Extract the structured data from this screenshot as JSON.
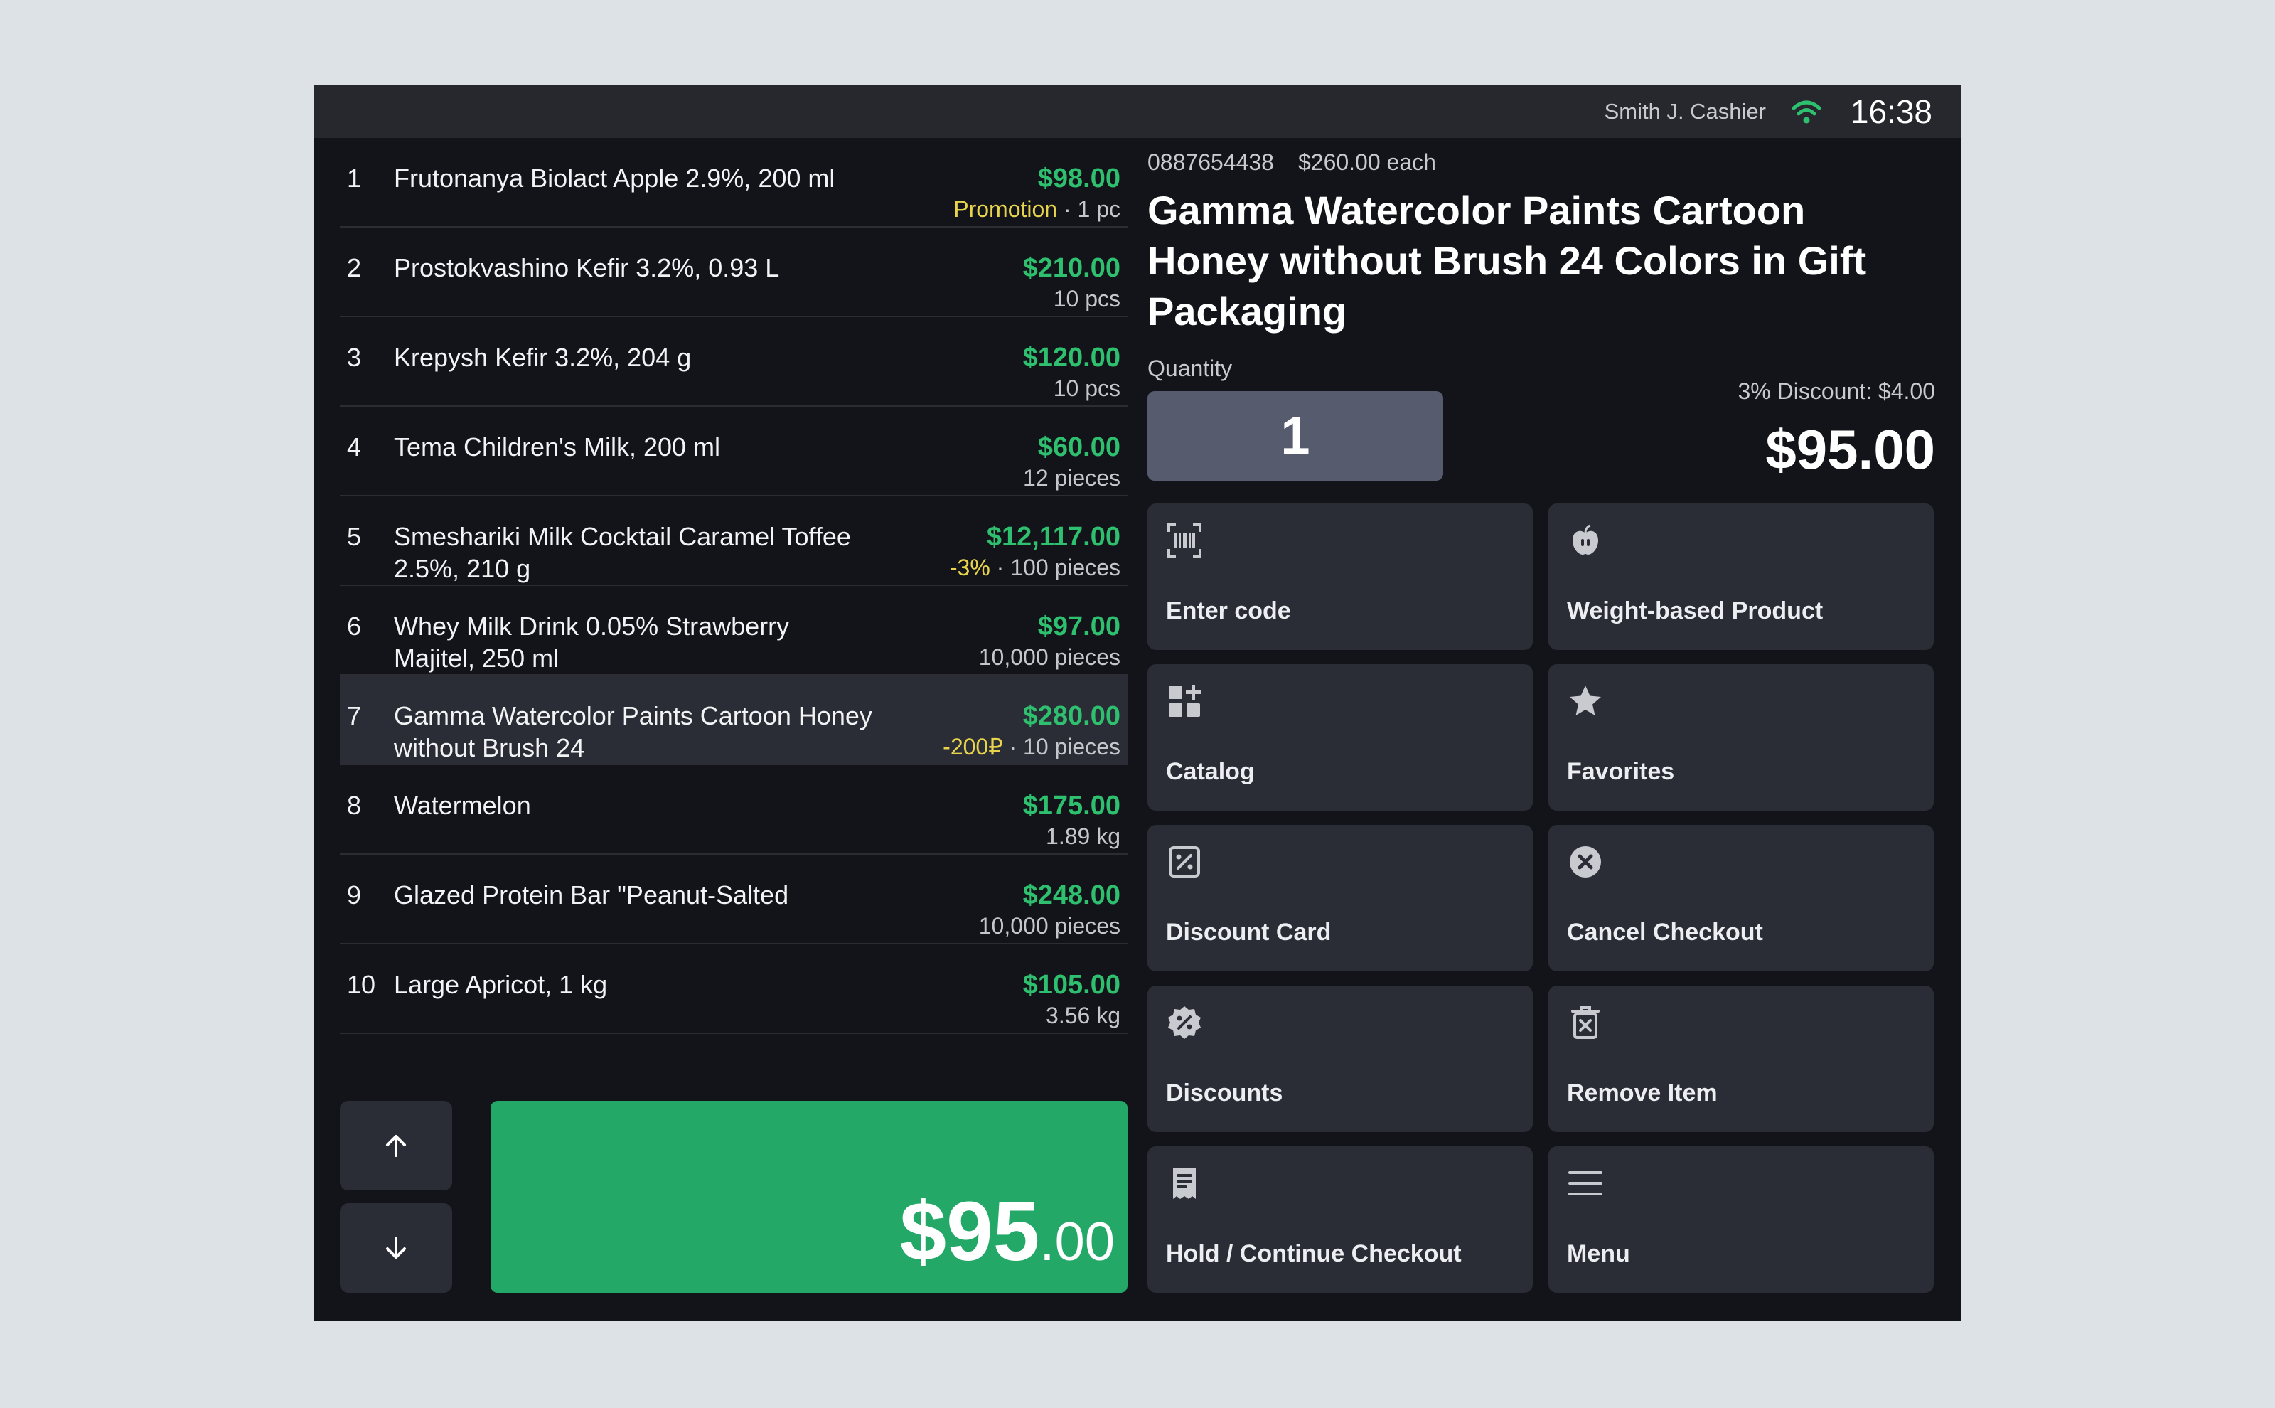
{
  "status": {
    "cashier": "Smith J. Cashier",
    "time": "16:38",
    "wifi_icon": "wifi-icon"
  },
  "receipt": [
    {
      "index": "1",
      "name": "Frutonanya Biolact Apple 2.9%, 200 ml",
      "price": "$98.00",
      "tag": "Promotion",
      "qty": "1 pc"
    },
    {
      "index": "2",
      "name": "Prostokvashino Kefir 3.2%, 0.93 L",
      "price": "$210.00",
      "tag": "",
      "qty": "10 pcs"
    },
    {
      "index": "3",
      "name": "Krepysh Kefir 3.2%, 204 g",
      "price": "$120.00",
      "tag": "",
      "qty": "10 pcs"
    },
    {
      "index": "4",
      "name": "Tema Children's Milk, 200 ml",
      "price": "$60.00",
      "tag": "",
      "qty": "12 pieces"
    },
    {
      "index": "5",
      "name": "Smeshariki Milk Cocktail Caramel Toffee 2.5%, 210 g",
      "price": "$12,117.00",
      "tag": "-3%",
      "qty": "100 pieces"
    },
    {
      "index": "6",
      "name": "Whey Milk Drink 0.05% Strawberry Majitel, 250 ml",
      "price": "$97.00",
      "tag": "",
      "qty": "10,000 pieces"
    },
    {
      "index": "7",
      "name": "Gamma Watercolor Paints Cartoon Honey without Brush 24",
      "price": "$280.00",
      "tag": "-200₽",
      "qty": "10 pieces",
      "selected": true
    },
    {
      "index": "8",
      "name": "Watermelon",
      "price": "$175.00",
      "tag": "",
      "qty": "1.89 kg"
    },
    {
      "index": "9",
      "name": "Glazed Protein Bar \"Peanut-Salted",
      "price": "$248.00",
      "tag": "",
      "qty": "10,000 pieces"
    },
    {
      "index": "10",
      "name": "Large Apricot, 1 kg",
      "price": "$105.00",
      "tag": "",
      "qty": "3.56 kg"
    }
  ],
  "nav": {
    "up_icon": "arrow-up-icon",
    "down_icon": "arrow-down-icon"
  },
  "total": {
    "main": "$95",
    "cents": ".00"
  },
  "product": {
    "code": "0887654438",
    "unit_price": "$260.00 each",
    "title": "Gamma Watercolor Paints Cartoon Honey without Brush 24 Colors in Gift Packaging",
    "quantity_label": "Quantity",
    "quantity": "1",
    "discount": "3% Discount: $4.00",
    "price": "$95.00"
  },
  "actions": {
    "enter_code": {
      "label": "Enter code",
      "icon": "barcode-scan-icon"
    },
    "weight": {
      "label": "Weight-based Product",
      "icon": "apple-icon"
    },
    "catalog": {
      "label": "Catalog",
      "icon": "catalog-grid-icon"
    },
    "favorites": {
      "label": "Favorites",
      "icon": "star-icon"
    },
    "discount_card": {
      "label": "Discount Card",
      "icon": "percent-card-icon"
    },
    "cancel": {
      "label": "Cancel Checkout",
      "icon": "close-circle-icon"
    },
    "discounts": {
      "label": "Discounts",
      "icon": "discount-badge-icon"
    },
    "remove": {
      "label": "Remove Item",
      "icon": "trash-icon"
    },
    "hold": {
      "label": "Hold / Continue Checkout",
      "icon": "receipt-icon"
    },
    "menu": {
      "label": "Menu",
      "icon": "menu-icon"
    }
  },
  "colors": {
    "accent": "#23a867",
    "price_green": "#2ebf6f",
    "tag_yellow": "#e8d34d",
    "panel": "#2b2d36",
    "background": "#131419"
  }
}
